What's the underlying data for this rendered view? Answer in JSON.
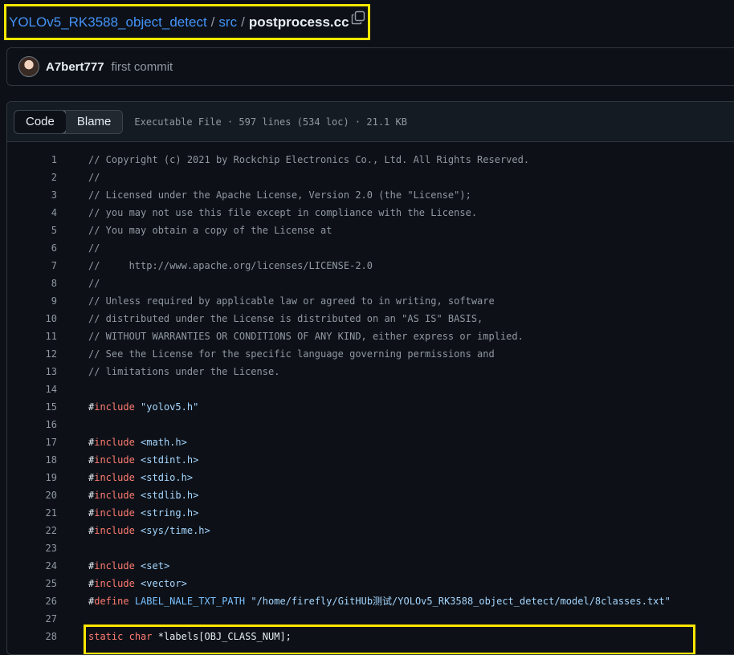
{
  "breadcrumb": {
    "repo": "YOLOv5_RK3588_object_detect",
    "sep1": "/",
    "folder": "src",
    "sep2": "/",
    "file": "postprocess.cc"
  },
  "commit": {
    "author": "A7bert777",
    "message": "first commit"
  },
  "file_header": {
    "tabs": [
      "Code",
      "Blame"
    ],
    "active_tab": "Code",
    "meta": "Executable File · 597 lines (534 loc) · 21.1 KB"
  },
  "code_lines": [
    {
      "n": "1",
      "parts": [
        {
          "t": "// Copyright (c) 2021 by Rockchip Electronics Co., Ltd. All Rights Reserved.",
          "c": "comment"
        }
      ]
    },
    {
      "n": "2",
      "parts": [
        {
          "t": "//",
          "c": "comment"
        }
      ]
    },
    {
      "n": "3",
      "parts": [
        {
          "t": "// Licensed under the Apache License, Version 2.0 (the \"License\");",
          "c": "comment"
        }
      ]
    },
    {
      "n": "4",
      "parts": [
        {
          "t": "// you may not use this file except in compliance with the License.",
          "c": "comment"
        }
      ]
    },
    {
      "n": "5",
      "parts": [
        {
          "t": "// You may obtain a copy of the License at",
          "c": "comment"
        }
      ]
    },
    {
      "n": "6",
      "parts": [
        {
          "t": "//",
          "c": "comment"
        }
      ]
    },
    {
      "n": "7",
      "parts": [
        {
          "t": "//     http://www.apache.org/licenses/LICENSE-2.0",
          "c": "comment"
        }
      ]
    },
    {
      "n": "8",
      "parts": [
        {
          "t": "//",
          "c": "comment"
        }
      ]
    },
    {
      "n": "9",
      "parts": [
        {
          "t": "// Unless required by applicable law or agreed to in writing, software",
          "c": "comment"
        }
      ]
    },
    {
      "n": "10",
      "parts": [
        {
          "t": "// distributed under the License is distributed on an \"AS IS\" BASIS,",
          "c": "comment"
        }
      ]
    },
    {
      "n": "11",
      "parts": [
        {
          "t": "// WITHOUT WARRANTIES OR CONDITIONS OF ANY KIND, either express or implied.",
          "c": "comment"
        }
      ]
    },
    {
      "n": "12",
      "parts": [
        {
          "t": "// See the License for the specific language governing permissions and",
          "c": "comment"
        }
      ]
    },
    {
      "n": "13",
      "parts": [
        {
          "t": "// limitations under the License.",
          "c": "comment"
        }
      ]
    },
    {
      "n": "14",
      "parts": []
    },
    {
      "n": "15",
      "parts": [
        {
          "t": "#",
          "c": "plain"
        },
        {
          "t": "include",
          "c": "kw"
        },
        {
          "t": " ",
          "c": "plain"
        },
        {
          "t": "\"yolov5.h\"",
          "c": "str"
        }
      ]
    },
    {
      "n": "16",
      "parts": []
    },
    {
      "n": "17",
      "parts": [
        {
          "t": "#",
          "c": "plain"
        },
        {
          "t": "include",
          "c": "kw"
        },
        {
          "t": " ",
          "c": "plain"
        },
        {
          "t": "<math.h>",
          "c": "str"
        }
      ]
    },
    {
      "n": "18",
      "parts": [
        {
          "t": "#",
          "c": "plain"
        },
        {
          "t": "include",
          "c": "kw"
        },
        {
          "t": " ",
          "c": "plain"
        },
        {
          "t": "<stdint.h>",
          "c": "str"
        }
      ]
    },
    {
      "n": "19",
      "parts": [
        {
          "t": "#",
          "c": "plain"
        },
        {
          "t": "include",
          "c": "kw"
        },
        {
          "t": " ",
          "c": "plain"
        },
        {
          "t": "<stdio.h>",
          "c": "str"
        }
      ]
    },
    {
      "n": "20",
      "parts": [
        {
          "t": "#",
          "c": "plain"
        },
        {
          "t": "include",
          "c": "kw"
        },
        {
          "t": " ",
          "c": "plain"
        },
        {
          "t": "<stdlib.h>",
          "c": "str"
        }
      ]
    },
    {
      "n": "21",
      "parts": [
        {
          "t": "#",
          "c": "plain"
        },
        {
          "t": "include",
          "c": "kw"
        },
        {
          "t": " ",
          "c": "plain"
        },
        {
          "t": "<string.h>",
          "c": "str"
        }
      ]
    },
    {
      "n": "22",
      "parts": [
        {
          "t": "#",
          "c": "plain"
        },
        {
          "t": "include",
          "c": "kw"
        },
        {
          "t": " ",
          "c": "plain"
        },
        {
          "t": "<sys/time.h>",
          "c": "str"
        }
      ]
    },
    {
      "n": "23",
      "parts": []
    },
    {
      "n": "24",
      "parts": [
        {
          "t": "#",
          "c": "plain"
        },
        {
          "t": "include",
          "c": "kw"
        },
        {
          "t": " ",
          "c": "plain"
        },
        {
          "t": "<set>",
          "c": "str"
        }
      ]
    },
    {
      "n": "25",
      "parts": [
        {
          "t": "#",
          "c": "plain"
        },
        {
          "t": "include",
          "c": "kw"
        },
        {
          "t": " ",
          "c": "plain"
        },
        {
          "t": "<vector>",
          "c": "str"
        }
      ]
    },
    {
      "n": "26",
      "parts": [
        {
          "t": "#",
          "c": "plain"
        },
        {
          "t": "define",
          "c": "kw"
        },
        {
          "t": " ",
          "c": "plain"
        },
        {
          "t": "LABEL_NALE_TXT_PATH",
          "c": "const"
        },
        {
          "t": " ",
          "c": "plain"
        },
        {
          "t": "\"/home/firefly/GitHUb测试/YOLOv5_RK3588_object_detect/model/8classes.txt\"",
          "c": "str"
        }
      ]
    },
    {
      "n": "27",
      "parts": []
    },
    {
      "n": "28",
      "parts": [
        {
          "t": "static",
          "c": "kw"
        },
        {
          "t": " ",
          "c": "plain"
        },
        {
          "t": "char",
          "c": "kw"
        },
        {
          "t": " *labels[OBJ_CLASS_NUM];",
          "c": "plain"
        }
      ]
    }
  ]
}
